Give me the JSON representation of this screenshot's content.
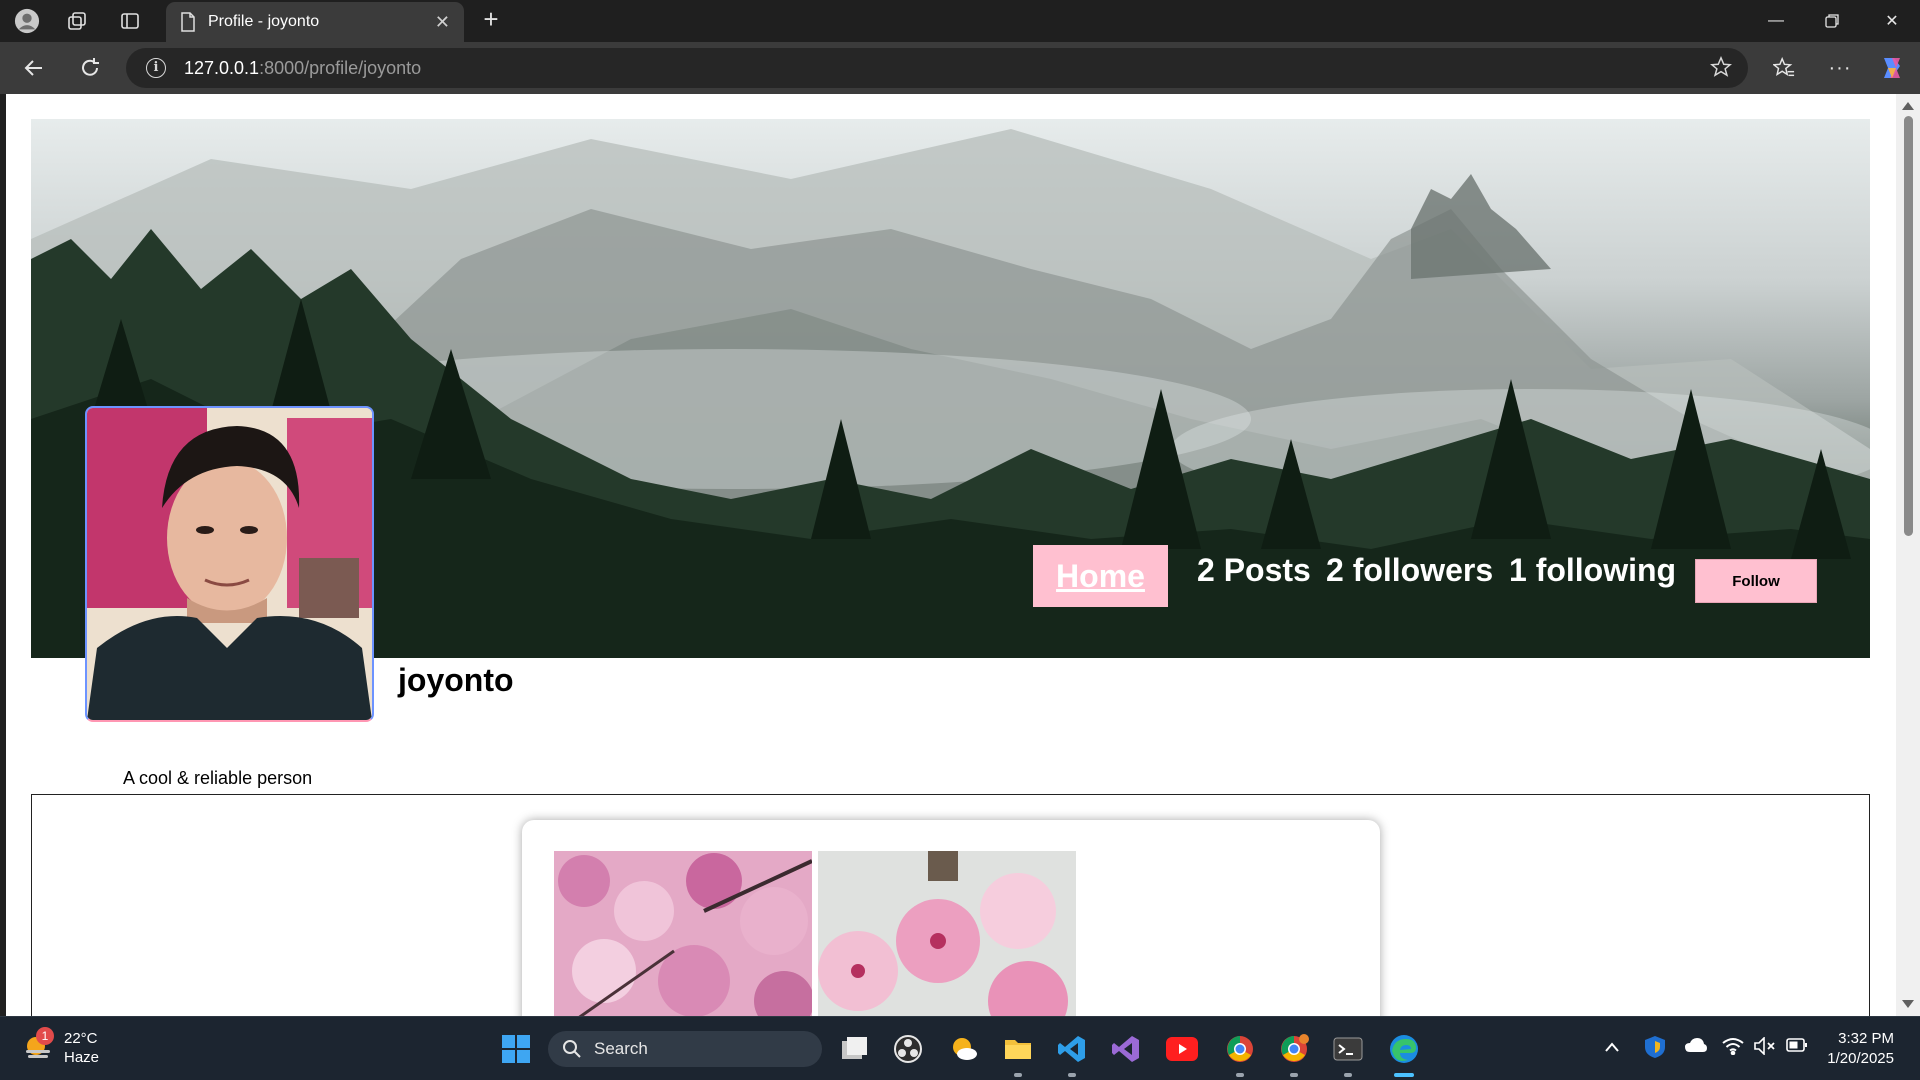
{
  "browser": {
    "tab_title": "Profile - joyonto",
    "url_host": "127.0.0.1",
    "url_rest": ":8000/profile/joyonto"
  },
  "profile": {
    "nav_home": "Home",
    "posts": "2 Posts",
    "followers": "2 followers",
    "following": "1 following",
    "follow_label": "Follow",
    "username": "joyonto",
    "bio": "A cool & reliable person"
  },
  "taskbar": {
    "weather_temp": "22°C",
    "weather_desc": "Haze",
    "weather_badge": "1",
    "search_label": "Search",
    "time": "3:32 PM",
    "date": "1/20/2025"
  },
  "colors": {
    "accent_pink": "#ffc0d0",
    "edge_blue": "#4cc2ff"
  }
}
